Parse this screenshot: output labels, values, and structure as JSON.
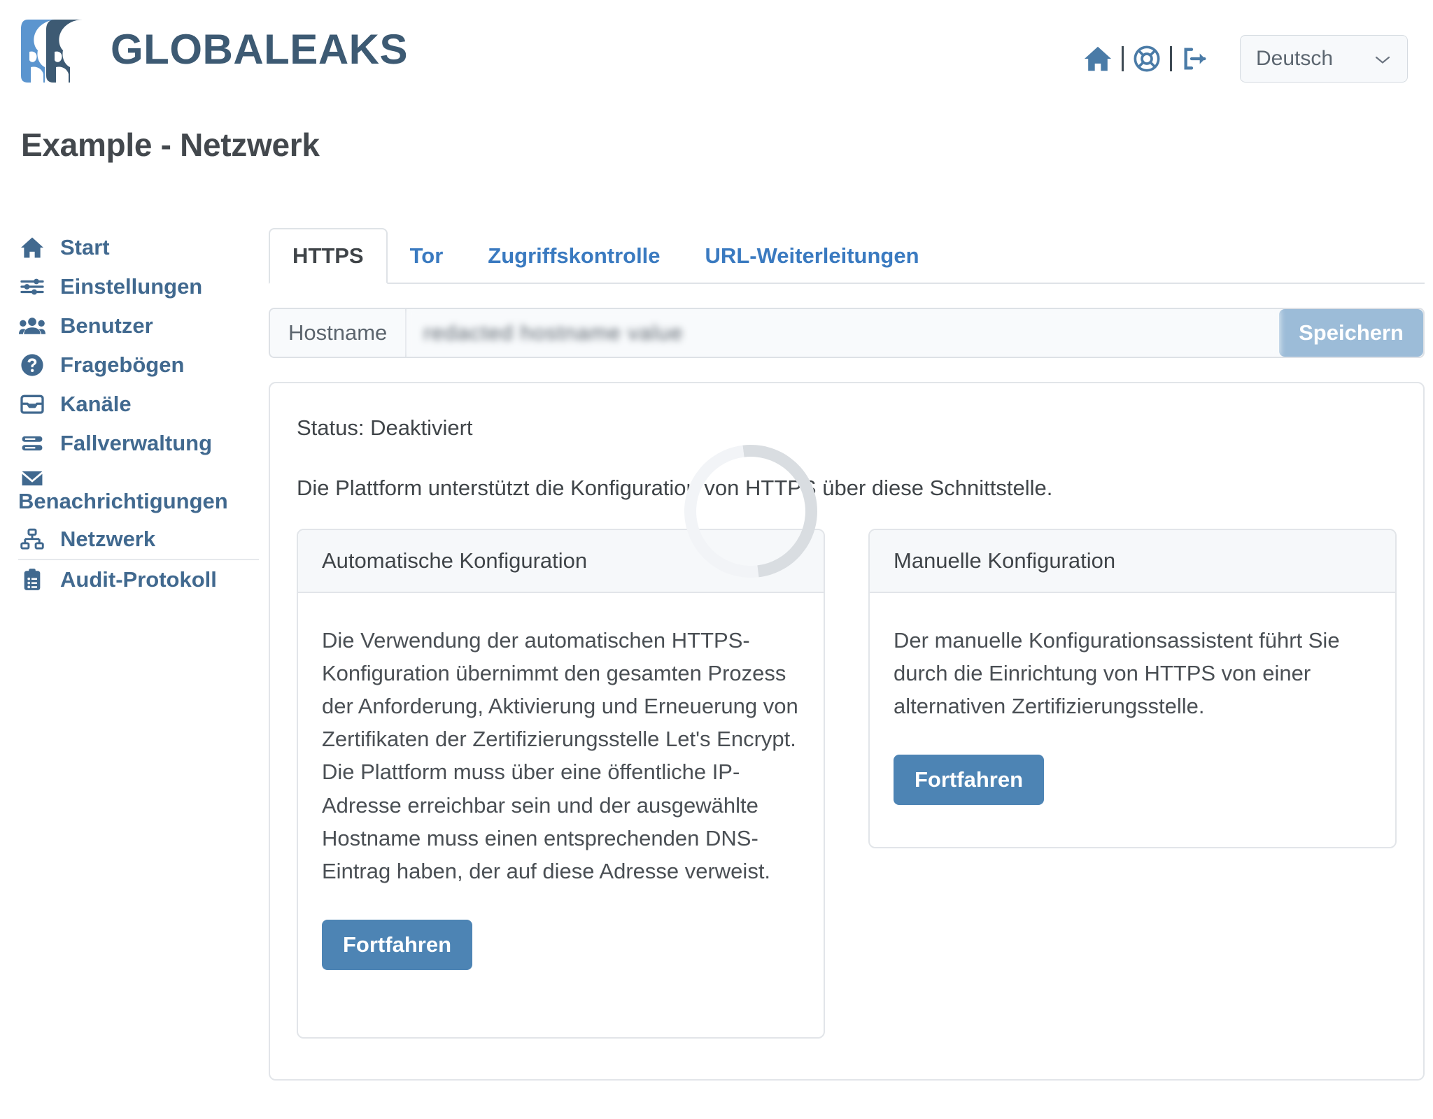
{
  "brand": {
    "name": "GLOBALEAKS",
    "logo_icon": "two-faces-logo"
  },
  "header": {
    "icons": [
      {
        "name": "home-icon",
        "label": "Start"
      },
      {
        "name": "lifebuoy-support-icon",
        "label": "Support"
      },
      {
        "name": "logout-icon",
        "label": "Abmelden"
      }
    ],
    "language": {
      "selected": "Deutsch",
      "chevron_icon": "chevron-down-icon"
    }
  },
  "page": {
    "title": "Example - Netzwerk"
  },
  "sidebar": {
    "items": [
      {
        "label": "Start",
        "icon": "home-icon"
      },
      {
        "label": "Einstellungen",
        "icon": "sliders-icon"
      },
      {
        "label": "Benutzer",
        "icon": "users-icon"
      },
      {
        "label": "Fragebögen",
        "icon": "question-circle-icon"
      },
      {
        "label": "Kanäle",
        "icon": "inbox-icon"
      },
      {
        "label": "Fallverwaltung",
        "icon": "list-rows-icon"
      },
      {
        "label": "Benachrichtigungen",
        "icon": "envelope-icon"
      },
      {
        "label": "Netzwerk",
        "icon": "sitemap-icon"
      },
      {
        "label": "Audit-Protokoll",
        "icon": "clipboard-list-icon"
      }
    ]
  },
  "tabs": [
    {
      "label": "HTTPS",
      "active": true
    },
    {
      "label": "Tor",
      "active": false
    },
    {
      "label": "Zugriffskontrolle",
      "active": false
    },
    {
      "label": "URL-Weiterleitungen",
      "active": false
    }
  ],
  "hostname": {
    "label": "Hostname",
    "value": "redacted hostname value",
    "placeholder": "",
    "save_label": "Speichern"
  },
  "https": {
    "status_line": "Status: Deaktiviert",
    "intro": "Die Plattform unterstützt die Konfiguration von HTTPS über diese Schnittstelle.",
    "cards": [
      {
        "title": "Automatische Konfiguration",
        "text": "Die Verwendung der automatischen HTTPS-Konfiguration übernimmt den gesamten Prozess der Anforderung, Aktivierung und Erneuerung von Zertifikaten der Zertifizierungsstelle Let's Encrypt. Die Plattform muss über eine öffentliche IP-Adresse erreichbar sein und der ausgewählte Hostname muss einen entsprechenden DNS-Eintrag haben, der auf diese Adresse verweist.",
        "button": "Fortfahren"
      },
      {
        "title": "Manuelle Konfiguration",
        "text": "Der manuelle Konfigurationsassistent führt Sie durch die Einrichtung von HTTPS von einer alternativen Zertifizierungsstelle.",
        "button": "Fortfahren"
      }
    ],
    "loading_spinner": "loading-spinner"
  },
  "colors": {
    "brand_dark": "#3d5a73",
    "brand_light": "#5b95cf",
    "link": "#3a7ac0",
    "sidebar_text": "#41698f",
    "primary_button": "#4d84b4",
    "save_button": "#9cbcd8",
    "border": "#e2e5e9",
    "card_head_bg": "#f6f8fa"
  }
}
